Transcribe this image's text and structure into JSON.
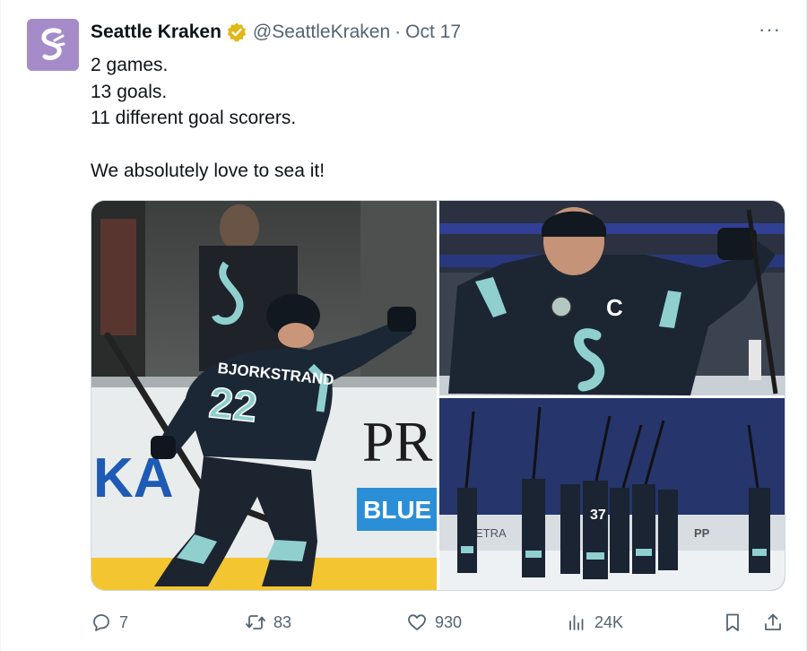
{
  "tweet": {
    "author_name": "Seattle Kraken",
    "handle": "@SeattleKraken",
    "separator": "·",
    "date": "Oct 17",
    "more_label": "···",
    "lines": [
      "2 games.",
      "13 goals.",
      "11 different goal scorers.",
      "",
      "We absolutely love to sea it!"
    ]
  },
  "media": {
    "image_1": {
      "jersey_name": "BJORKSTRAND",
      "jersey_number": "22",
      "board_text_left": "KA",
      "board_text_right": "PR",
      "board_text_blue": "BLUE"
    },
    "image_2": {
      "captain_letter": "C"
    },
    "image_3": {
      "board_text_left": "ETRA",
      "board_text_right": "PP",
      "jersey_number": "37"
    }
  },
  "actions": {
    "replies": "7",
    "reposts": "83",
    "likes": "930",
    "views": "24K"
  },
  "colors": {
    "accent": "#a58cc9",
    "text_primary": "#0f1419",
    "text_secondary": "#536471",
    "verified_gold": "#e2b719",
    "kraken_navy": "#1a2635",
    "kraken_ice": "#99d9d9"
  },
  "icons": {
    "avatar": "kraken-logo",
    "verified": "verified-badge-icon",
    "reply": "reply-icon",
    "repost": "repost-icon",
    "like": "heart-icon",
    "views": "views-chart-icon",
    "bookmark": "bookmark-icon",
    "share": "share-icon"
  }
}
